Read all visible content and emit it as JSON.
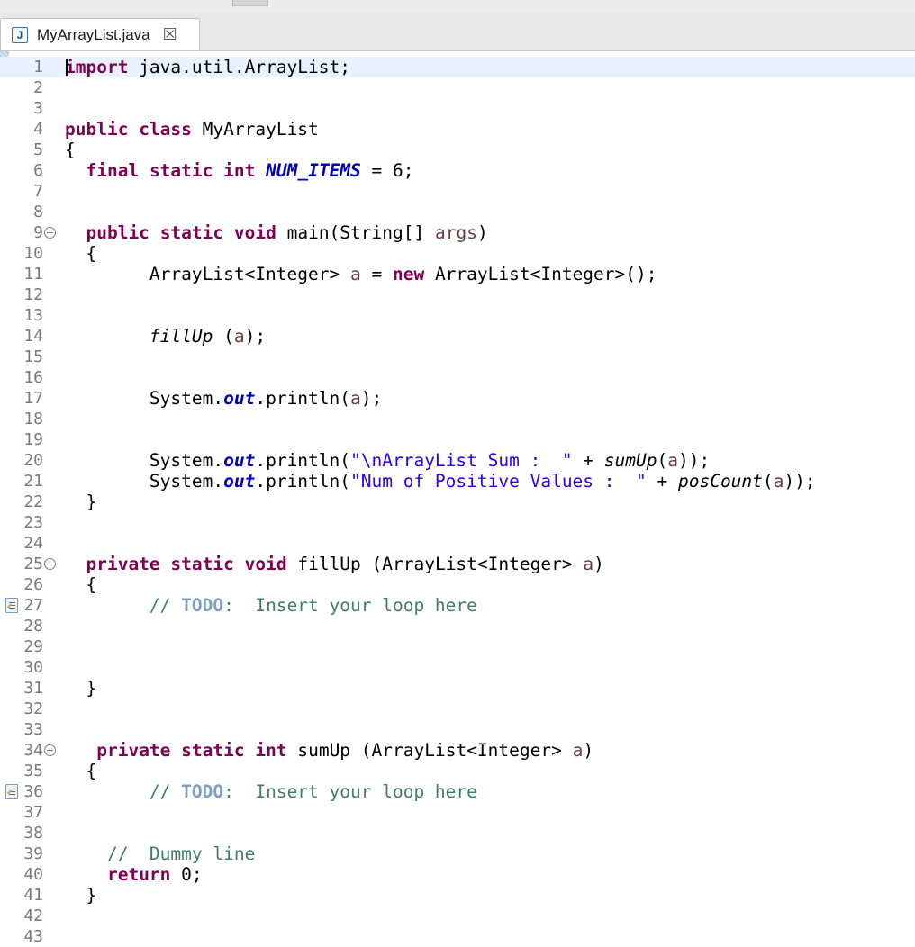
{
  "tab": {
    "file_icon": "J",
    "title": "MyArrayList.java",
    "close_glyph": "☒"
  },
  "editor": {
    "lines": [
      {
        "n": "1",
        "tokens": [
          [
            "kw",
            "import"
          ],
          [
            "pln",
            " java.util.ArrayList;"
          ]
        ]
      },
      {
        "n": "2",
        "tokens": []
      },
      {
        "n": "3",
        "tokens": []
      },
      {
        "n": "4",
        "tokens": [
          [
            "kw",
            "public"
          ],
          [
            "pln",
            " "
          ],
          [
            "kw",
            "class"
          ],
          [
            "pln",
            " MyArrayList"
          ]
        ]
      },
      {
        "n": "5",
        "tokens": [
          [
            "pln",
            "{"
          ]
        ]
      },
      {
        "n": "6",
        "tokens": [
          [
            "pln",
            "  "
          ],
          [
            "kw",
            "final"
          ],
          [
            "pln",
            " "
          ],
          [
            "kw",
            "static"
          ],
          [
            "pln",
            " "
          ],
          [
            "kw",
            "int"
          ],
          [
            "pln",
            " "
          ],
          [
            "sfld",
            "NUM_ITEMS"
          ],
          [
            "pln",
            " = 6;"
          ]
        ]
      },
      {
        "n": "7",
        "tokens": []
      },
      {
        "n": "8",
        "tokens": []
      },
      {
        "n": "9",
        "fold": true,
        "tokens": [
          [
            "pln",
            "  "
          ],
          [
            "kw",
            "public"
          ],
          [
            "pln",
            " "
          ],
          [
            "kw",
            "static"
          ],
          [
            "pln",
            " "
          ],
          [
            "kw",
            "void"
          ],
          [
            "pln",
            " main(String[] "
          ],
          [
            "var",
            "args"
          ],
          [
            "pln",
            ")"
          ]
        ]
      },
      {
        "n": "10",
        "tokens": [
          [
            "pln",
            "  {"
          ]
        ]
      },
      {
        "n": "11",
        "tokens": [
          [
            "pln",
            "        ArrayList<Integer> "
          ],
          [
            "var",
            "a"
          ],
          [
            "pln",
            " = "
          ],
          [
            "kw",
            "new"
          ],
          [
            "pln",
            " ArrayList<Integer>();"
          ]
        ]
      },
      {
        "n": "12",
        "tokens": []
      },
      {
        "n": "13",
        "tokens": []
      },
      {
        "n": "14",
        "tokens": [
          [
            "pln",
            "        "
          ],
          [
            "mcall",
            "fillUp"
          ],
          [
            "pln",
            " ("
          ],
          [
            "var",
            "a"
          ],
          [
            "pln",
            ");"
          ]
        ]
      },
      {
        "n": "15",
        "tokens": []
      },
      {
        "n": "16",
        "tokens": []
      },
      {
        "n": "17",
        "tokens": [
          [
            "pln",
            "        System."
          ],
          [
            "sfld",
            "out"
          ],
          [
            "pln",
            ".println("
          ],
          [
            "var",
            "a"
          ],
          [
            "pln",
            ");"
          ]
        ]
      },
      {
        "n": "18",
        "tokens": []
      },
      {
        "n": "19",
        "tokens": []
      },
      {
        "n": "20",
        "tokens": [
          [
            "pln",
            "        System."
          ],
          [
            "sfld",
            "out"
          ],
          [
            "pln",
            ".println("
          ],
          [
            "str",
            "\"\\nArrayList Sum :  \""
          ],
          [
            "pln",
            " + "
          ],
          [
            "mcall",
            "sumUp"
          ],
          [
            "pln",
            "("
          ],
          [
            "var",
            "a"
          ],
          [
            "pln",
            "));"
          ]
        ]
      },
      {
        "n": "21",
        "tokens": [
          [
            "pln",
            "        System."
          ],
          [
            "sfld",
            "out"
          ],
          [
            "pln",
            ".println("
          ],
          [
            "str",
            "\"Num of Positive Values :  \""
          ],
          [
            "pln",
            " + "
          ],
          [
            "mcall",
            "posCount"
          ],
          [
            "pln",
            "("
          ],
          [
            "var",
            "a"
          ],
          [
            "pln",
            "));"
          ]
        ]
      },
      {
        "n": "22",
        "tokens": [
          [
            "pln",
            "  }"
          ]
        ]
      },
      {
        "n": "23",
        "tokens": []
      },
      {
        "n": "24",
        "tokens": []
      },
      {
        "n": "25",
        "fold": true,
        "tokens": [
          [
            "pln",
            "  "
          ],
          [
            "kw",
            "private"
          ],
          [
            "pln",
            " "
          ],
          [
            "kw",
            "static"
          ],
          [
            "pln",
            " "
          ],
          [
            "kw",
            "void"
          ],
          [
            "pln",
            " fillUp (ArrayList<Integer> "
          ],
          [
            "var",
            "a"
          ],
          [
            "pln",
            ")"
          ]
        ]
      },
      {
        "n": "26",
        "tokens": [
          [
            "pln",
            "  {"
          ]
        ]
      },
      {
        "n": "27",
        "task": true,
        "tokens": [
          [
            "pln",
            "        "
          ],
          [
            "cmt",
            "// "
          ],
          [
            "todo",
            "TODO"
          ],
          [
            "cmt",
            ":  Insert your loop here"
          ]
        ]
      },
      {
        "n": "28",
        "tokens": []
      },
      {
        "n": "29",
        "tokens": []
      },
      {
        "n": "30",
        "tokens": []
      },
      {
        "n": "31",
        "tokens": [
          [
            "pln",
            "  }"
          ]
        ]
      },
      {
        "n": "32",
        "tokens": []
      },
      {
        "n": "33",
        "tokens": []
      },
      {
        "n": "34",
        "fold": true,
        "tokens": [
          [
            "pln",
            "   "
          ],
          [
            "kw",
            "private"
          ],
          [
            "pln",
            " "
          ],
          [
            "kw",
            "static"
          ],
          [
            "pln",
            " "
          ],
          [
            "kw",
            "int"
          ],
          [
            "pln",
            " sumUp (ArrayList<Integer> "
          ],
          [
            "var",
            "a"
          ],
          [
            "pln",
            ")"
          ]
        ]
      },
      {
        "n": "35",
        "tokens": [
          [
            "pln",
            "  {"
          ]
        ]
      },
      {
        "n": "36",
        "task": true,
        "tokens": [
          [
            "pln",
            "        "
          ],
          [
            "cmt",
            "// "
          ],
          [
            "todo",
            "TODO"
          ],
          [
            "cmt",
            ":  Insert your loop here"
          ]
        ]
      },
      {
        "n": "37",
        "tokens": []
      },
      {
        "n": "38",
        "tokens": []
      },
      {
        "n": "39",
        "tokens": [
          [
            "pln",
            "    "
          ],
          [
            "cmt",
            "//  Dummy line"
          ]
        ]
      },
      {
        "n": "40",
        "tokens": [
          [
            "pln",
            "    "
          ],
          [
            "kw",
            "return"
          ],
          [
            "pln",
            " 0;"
          ]
        ]
      },
      {
        "n": "41",
        "tokens": [
          [
            "pln",
            "  }"
          ]
        ]
      },
      {
        "n": "42",
        "tokens": []
      },
      {
        "n": "43",
        "tokens": []
      }
    ]
  }
}
